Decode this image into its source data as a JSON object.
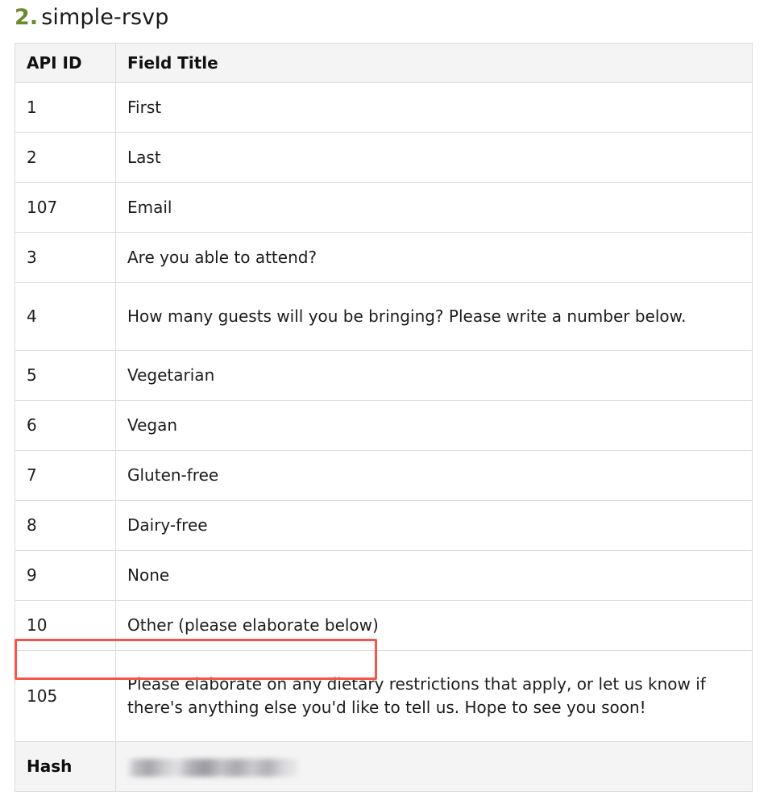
{
  "heading": {
    "number": "2.",
    "name": "simple-rsvp",
    "number_color": "#6a8a2b",
    "name_color": "#1a1a1a"
  },
  "table": {
    "columns": [
      "API ID",
      "Field Title"
    ],
    "rows": [
      {
        "api_id": "1",
        "field_title": "First"
      },
      {
        "api_id": "2",
        "field_title": "Last"
      },
      {
        "api_id": "107",
        "field_title": "Email"
      },
      {
        "api_id": "3",
        "field_title": "Are you able to attend?"
      },
      {
        "api_id": "4",
        "field_title": "How many guests will you be bringing? Please write a number below."
      },
      {
        "api_id": "5",
        "field_title": "Vegetarian"
      },
      {
        "api_id": "6",
        "field_title": "Vegan"
      },
      {
        "api_id": "7",
        "field_title": "Gluten-free"
      },
      {
        "api_id": "8",
        "field_title": "Dairy-free"
      },
      {
        "api_id": "9",
        "field_title": "None"
      },
      {
        "api_id": "10",
        "field_title": "Other (please elaborate below)"
      },
      {
        "api_id": "105",
        "field_title": "Please elaborate on any dietary restrictions that apply, or let us know if there's anything else you'd like to tell us. Hope to see you soon!"
      }
    ],
    "hash_row": {
      "label": "Hash",
      "value": "",
      "value_state": "redacted-blurred",
      "highlight_color": "#f4574a"
    }
  }
}
